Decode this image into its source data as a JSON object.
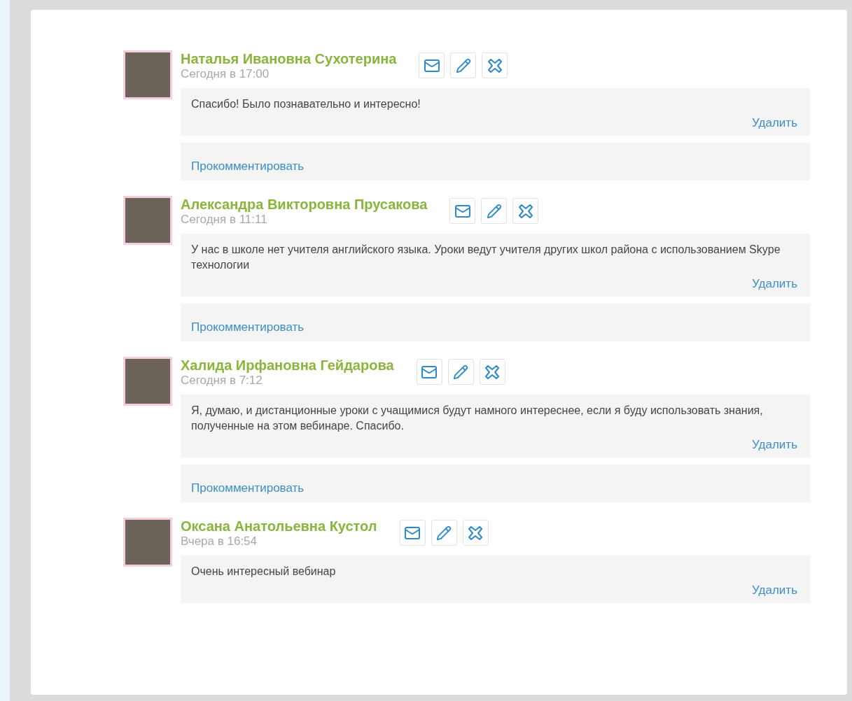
{
  "posts": [
    {
      "author": "Наталья Ивановна Сухотерина",
      "time": "Сегодня в 17:00",
      "message": "Спасибо! Было познавательно и интересно!",
      "delete_link": "Удалить",
      "comment_link": "Прокомментировать"
    },
    {
      "author": "Александра Викторовна Прусакова",
      "time": "Сегодня в 11:11",
      "message": "У нас в школе нет учителя английского языка. Уроки ведут учителя других школ района с использованием Skype технологии",
      "delete_link": "Удалить",
      "comment_link": "Прокомментировать"
    },
    {
      "author": "Халида Ирфановна Гейдарова",
      "time": "Сегодня в 7:12",
      "message": "Я, думаю, и дистанционные уроки с учащимися будут намного интереснее, если я буду использовать знания, полученные на этом вебинаре. Спасибо.",
      "delete_link": "Удалить",
      "comment_link": "Прокомментировать"
    },
    {
      "author": "Оксана Анатольевна Кустол",
      "time": "Вчера в 16:54",
      "message": "Очень интересный вебинар",
      "delete_link": "Удалить"
    }
  ]
}
